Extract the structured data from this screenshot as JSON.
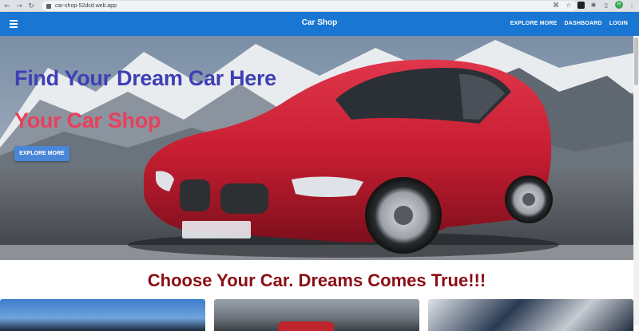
{
  "browser": {
    "url": "car-shop-52dcd.web.app",
    "avatar_initial": "R"
  },
  "appbar": {
    "title": "Car Shop",
    "links": [
      "EXPLORE MORE",
      "DASHBOARD",
      "LOGIN"
    ]
  },
  "hero": {
    "title": "Find Your Dream Car Here",
    "subtitle": "Your Car Shop",
    "button_label": "EXPLORE MORE",
    "plate_text": "M·BY 5803"
  },
  "section": {
    "title": "Choose Your Car. Dreams Comes True!!!"
  },
  "colors": {
    "appbar": "#1976d2",
    "hero_title": "#3f3fb5",
    "hero_subtitle": "#e8405d",
    "section_title": "#8b0d14",
    "car_body": "#c81e32"
  }
}
